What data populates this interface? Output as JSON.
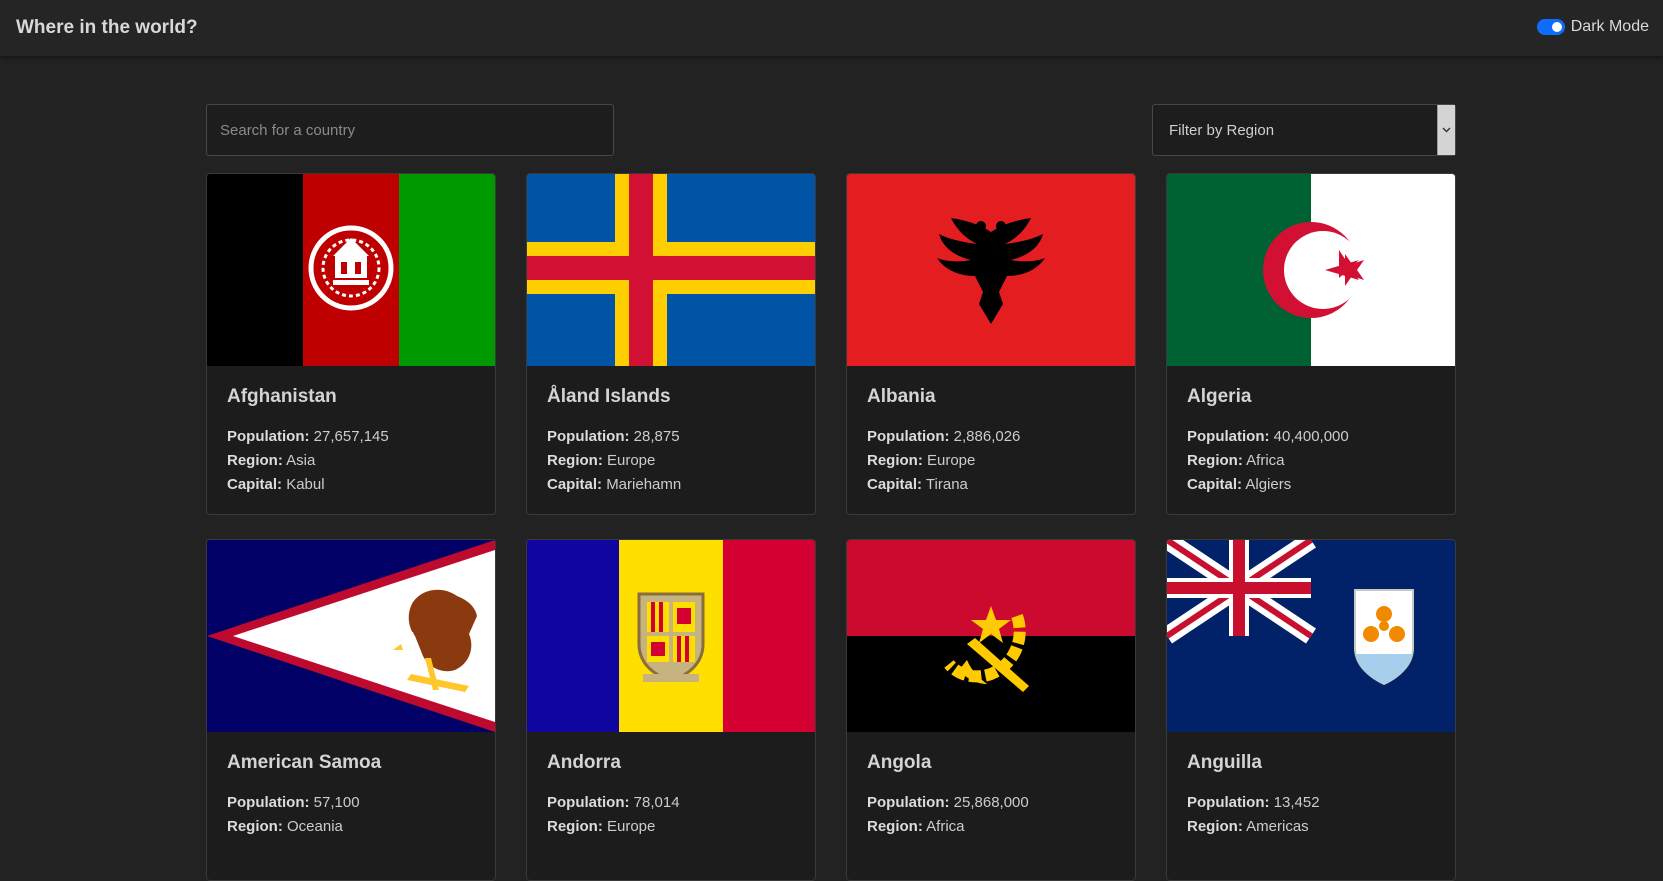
{
  "header": {
    "title": "Where in the world?",
    "mode_label": "Dark Mode"
  },
  "search": {
    "placeholder": "Search for a country",
    "value": ""
  },
  "filter": {
    "label": "Filter by Region"
  },
  "labels": {
    "population": "Population:",
    "region": "Region:",
    "capital": "Capital:"
  },
  "countries": [
    {
      "name": "Afghanistan",
      "population": "27,657,145",
      "region": "Asia",
      "capital": "Kabul"
    },
    {
      "name": "Åland Islands",
      "population": "28,875",
      "region": "Europe",
      "capital": "Mariehamn"
    },
    {
      "name": "Albania",
      "population": "2,886,026",
      "region": "Europe",
      "capital": "Tirana"
    },
    {
      "name": "Algeria",
      "population": "40,400,000",
      "region": "Africa",
      "capital": "Algiers"
    },
    {
      "name": "American Samoa",
      "population": "57,100",
      "region": "Oceania",
      "capital": ""
    },
    {
      "name": "Andorra",
      "population": "78,014",
      "region": "Europe",
      "capital": ""
    },
    {
      "name": "Angola",
      "population": "25,868,000",
      "region": "Africa",
      "capital": ""
    },
    {
      "name": "Anguilla",
      "population": "13,452",
      "region": "Americas",
      "capital": ""
    }
  ],
  "colors": {
    "background": "#222222",
    "header": "#252525",
    "card": "#1c1c1c",
    "toggle": "#0d6efd"
  }
}
